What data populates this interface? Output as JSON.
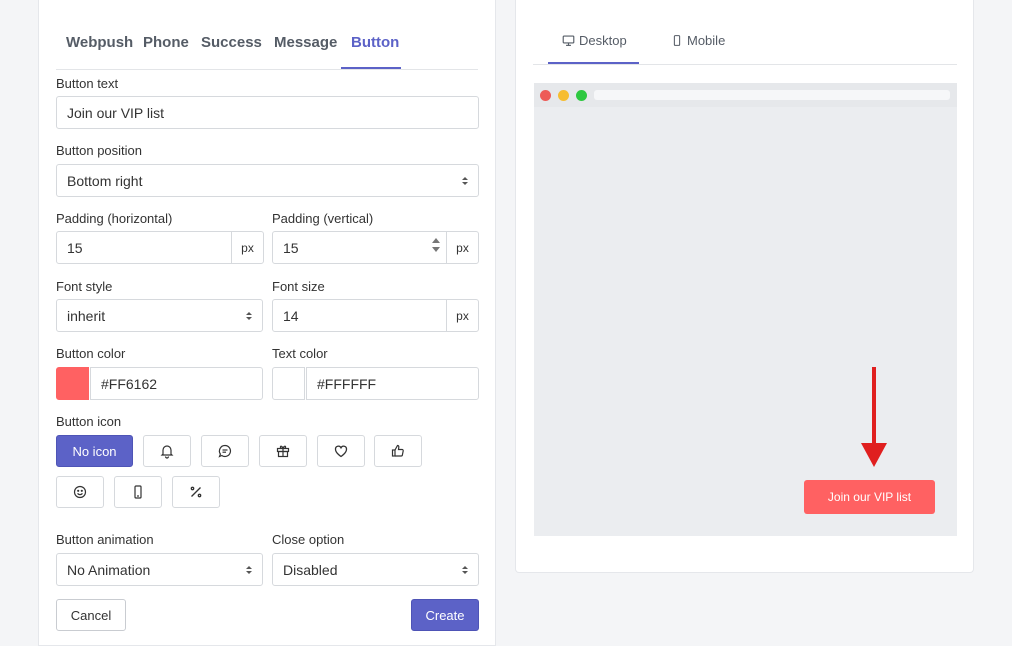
{
  "editor": {
    "tabs": [
      {
        "label": "Webpush"
      },
      {
        "label": "Phone"
      },
      {
        "label": "Success"
      },
      {
        "label": "Message"
      },
      {
        "label": "Button",
        "active": true
      }
    ],
    "button_text": {
      "label": "Button text",
      "value": "Join our VIP list"
    },
    "button_position": {
      "label": "Button position",
      "value": "Bottom right"
    },
    "padding_h": {
      "label": "Padding (horizontal)",
      "value": "15",
      "unit": "px"
    },
    "padding_v": {
      "label": "Padding (vertical)",
      "value": "15",
      "unit": "px"
    },
    "font_style": {
      "label": "Font style",
      "value": "inherit"
    },
    "font_size": {
      "label": "Font size",
      "value": "14",
      "unit": "px"
    },
    "button_color": {
      "label": "Button color",
      "value": "#FF6162"
    },
    "text_color": {
      "label": "Text color",
      "value": "#FFFFFF"
    },
    "button_icon": {
      "label": "Button icon",
      "no_icon_label": "No icon",
      "icons": [
        "bell-icon",
        "chat-icon",
        "gift-icon",
        "heart-icon",
        "thumbs-up-icon",
        "smile-icon",
        "mobile-icon",
        "percent-icon"
      ]
    },
    "button_animation": {
      "label": "Button animation",
      "value": "No Animation"
    },
    "close_option": {
      "label": "Close option",
      "value": "Disabled"
    },
    "cancel_label": "Cancel",
    "create_label": "Create"
  },
  "preview": {
    "tabs": [
      {
        "label": "Desktop",
        "icon": "desktop-icon",
        "active": true
      },
      {
        "label": "Mobile",
        "icon": "mobile-icon"
      }
    ],
    "button_label": "Join our VIP list",
    "colors": {
      "close": "#ED5B57",
      "minimize": "#F6BD30",
      "maximize": "#2DC840",
      "accent": "#5C62C7",
      "arrow": "#E01F1F"
    }
  }
}
